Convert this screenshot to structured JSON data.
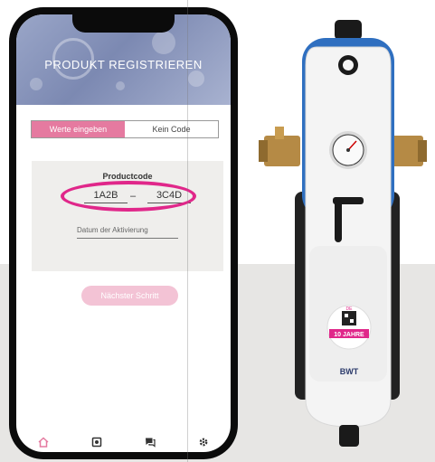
{
  "app": {
    "header_title": "PRODUKT REGISTRIEREN"
  },
  "segmented_control": {
    "enter_values_label": "Werte eingeben",
    "no_code_label": "Kein Code"
  },
  "code_card": {
    "title": "Productcode",
    "code_part_1": "1A2B",
    "dash": "–",
    "code_part_2": "3C4D",
    "activation_date_label": "Datum der Aktivierung"
  },
  "next_button_label": "Nächster Schritt",
  "tab_bar": {
    "items": [
      "home-icon",
      "product-icon",
      "chat-icon",
      "gear-icon"
    ]
  },
  "product": {
    "brand": "BWT",
    "badge_country": "DE",
    "badge_years": "10 JAHRE"
  },
  "colors": {
    "accent_pink": "#e57aa0",
    "highlight_magenta": "#e0278a",
    "product_blue": "#2f6fc0"
  }
}
